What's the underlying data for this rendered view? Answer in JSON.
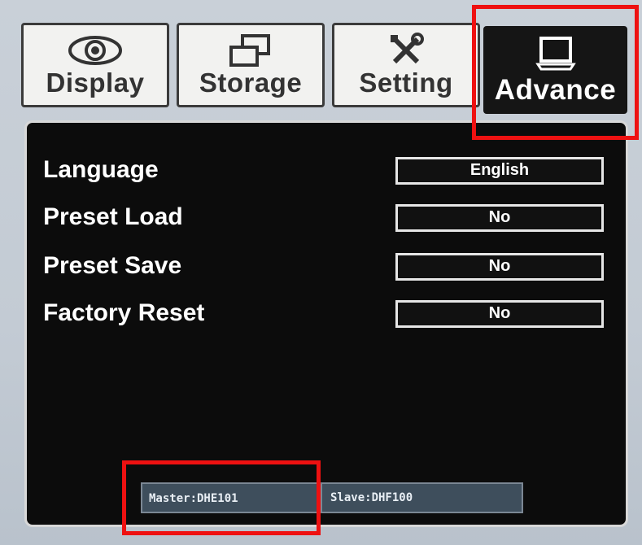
{
  "tabs": [
    {
      "label": "Display",
      "icon": "eye-icon",
      "active": false
    },
    {
      "label": "Storage",
      "icon": "overlapping-windows-icon",
      "active": false
    },
    {
      "label": "Setting",
      "icon": "tools-icon",
      "active": false
    },
    {
      "label": "Advance",
      "icon": "laptop-icon",
      "active": true
    }
  ],
  "settings": [
    {
      "label": "Language",
      "value": "English"
    },
    {
      "label": "Preset Load",
      "value": "No"
    },
    {
      "label": "Preset Save",
      "value": "No"
    },
    {
      "label": "Factory Reset",
      "value": "No"
    }
  ],
  "status": {
    "master": "Master:DHE101",
    "slave": "Slave:DHF100"
  },
  "colors": {
    "highlight": "#ee1111",
    "panel_bg": "#0c0c0c",
    "active_tab_bg": "#151515",
    "status_bg": "#3e4e5c"
  }
}
